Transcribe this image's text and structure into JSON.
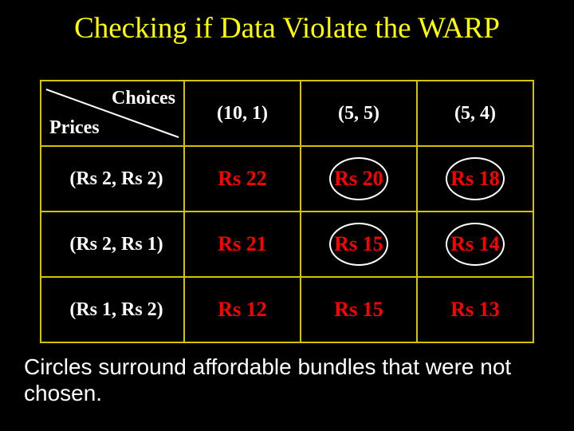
{
  "title": "Checking if Data Violate the WARP",
  "header": {
    "choices_label": "Choices",
    "prices_label": "Prices",
    "columns": [
      "(10, 1)",
      "(5, 5)",
      "(5, 4)"
    ]
  },
  "rows": [
    {
      "price_label": "(Rs 2, Rs 2)",
      "values": [
        "Rs 22",
        "Rs 20",
        "Rs 18"
      ],
      "circles": [
        false,
        true,
        true
      ]
    },
    {
      "price_label": "(Rs 2, Rs 1)",
      "values": [
        "Rs 21",
        "Rs 15",
        "Rs 14"
      ],
      "circles": [
        false,
        true,
        true
      ]
    },
    {
      "price_label": "(Rs 1, Rs 2)",
      "values": [
        "Rs 12",
        "Rs 15",
        "Rs 13"
      ],
      "circles": [
        false,
        false,
        false
      ]
    }
  ],
  "caption": "Circles surround affordable bundles that were not chosen.",
  "chart_data": {
    "type": "table",
    "title": "Checking if Data Violate the WARP",
    "row_labels": [
      "(Rs 2, Rs 2)",
      "(Rs 2, Rs 1)",
      "(Rs 1, Rs 2)"
    ],
    "col_labels": [
      "(10, 1)",
      "(5, 5)",
      "(5, 4)"
    ],
    "values": [
      [
        22,
        20,
        18
      ],
      [
        21,
        15,
        14
      ],
      [
        12,
        15,
        13
      ]
    ],
    "unit": "Rs",
    "circled_cells": [
      [
        0,
        1
      ],
      [
        0,
        2
      ],
      [
        1,
        1
      ],
      [
        1,
        2
      ]
    ],
    "note": "Circles surround affordable bundles that were not chosen."
  }
}
